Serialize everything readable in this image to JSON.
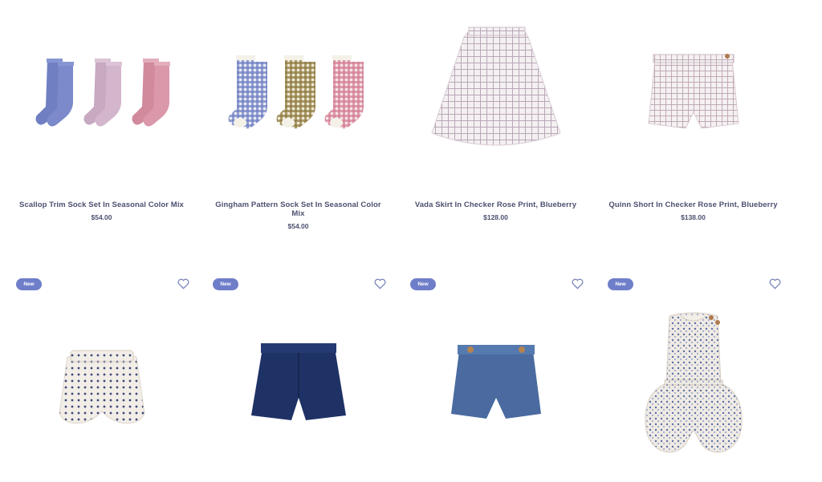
{
  "products": [
    {
      "title": "Scallop Trim Sock Set In Seasonal Color Mix",
      "price": "$54.00",
      "image_icon": "sock-set-icon"
    },
    {
      "title": "Gingham Pattern Sock Set In Seasonal Color Mix",
      "price": "$54.00",
      "image_icon": "gingham-sock-set-icon"
    },
    {
      "title": "Vada Skirt In Checker Rose Print, Blueberry",
      "price": "$128.00",
      "image_icon": "skirt-icon"
    },
    {
      "title": "Quinn Short In Checker Rose Print, Blueberry",
      "price": "$138.00",
      "image_icon": "short-icon"
    },
    {
      "badge": "New",
      "image_icon": "bloomer-icon"
    },
    {
      "badge": "New",
      "image_icon": "denim-short-icon"
    },
    {
      "badge": "New",
      "image_icon": "chambray-short-icon"
    },
    {
      "badge": "New",
      "image_icon": "romper-icon"
    }
  ],
  "colors": {
    "badge_bg": "#6f7ec9",
    "text": "#4c5170",
    "heart": "#7a83b8"
  }
}
